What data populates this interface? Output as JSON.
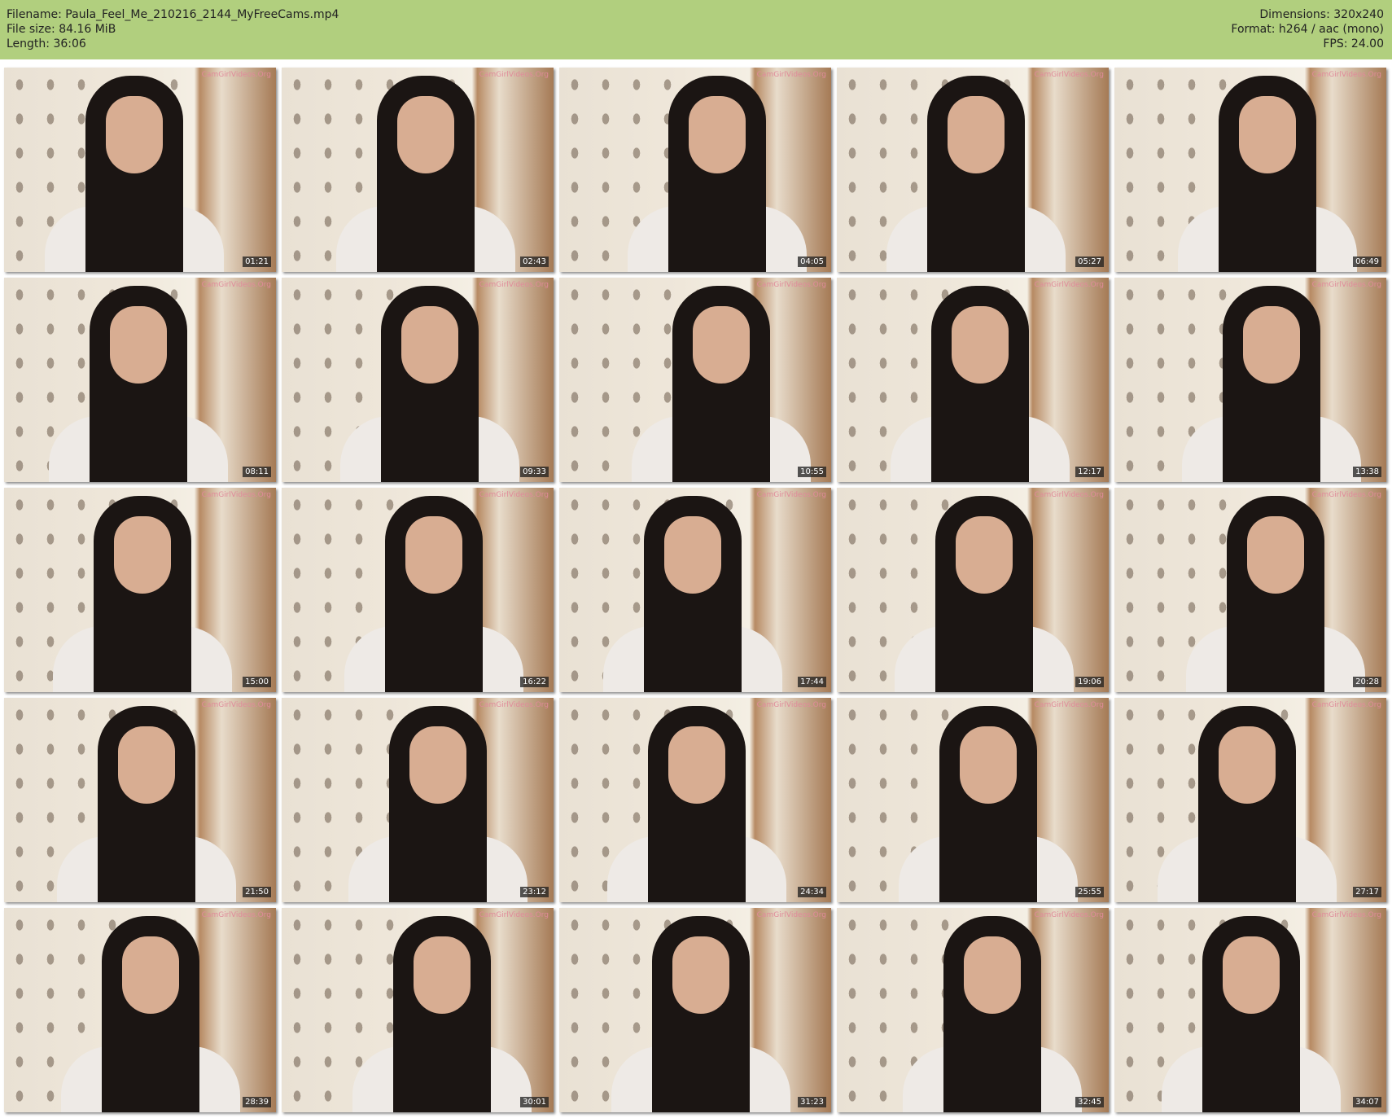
{
  "header": {
    "filename": "Filename: Paula_Feel_Me_210216_2144_MyFreeCams.mp4",
    "file_size": "File size: 84.16 MiB",
    "length": "Length: 36:06",
    "dimensions": "Dimensions: 320x240",
    "format": "Format: h264 / aac (mono)",
    "fps": "FPS: 24.00"
  },
  "watermark": "CamGirlVideos.Org",
  "thumbnails": [
    "01:21",
    "02:43",
    "04:05",
    "05:27",
    "06:49",
    "08:11",
    "09:33",
    "10:55",
    "12:17",
    "13:38",
    "15:00",
    "16:22",
    "17:44",
    "19:06",
    "20:28",
    "21:50",
    "23:12",
    "24:34",
    "25:55",
    "27:17",
    "28:39",
    "30:01",
    "31:23",
    "32:45",
    "34:07"
  ]
}
